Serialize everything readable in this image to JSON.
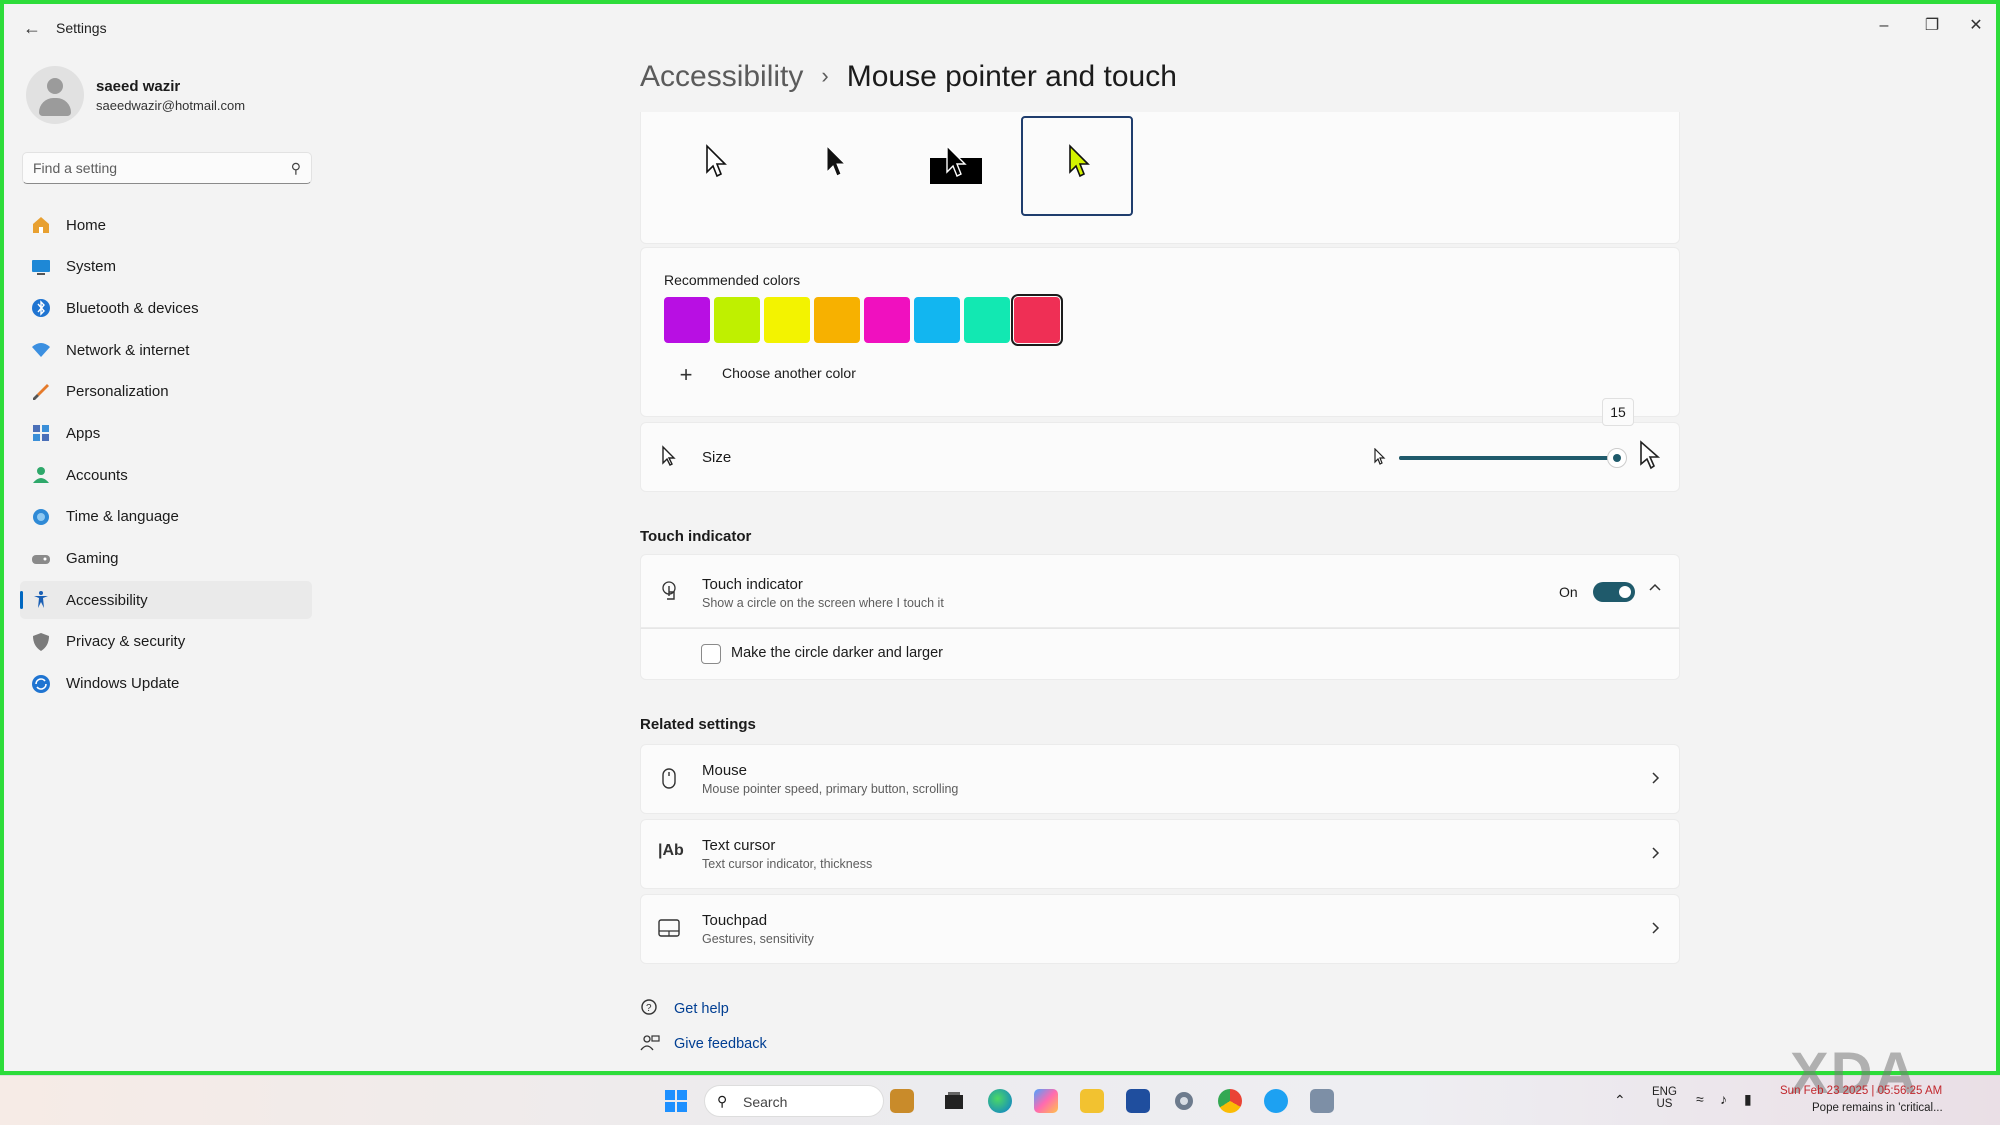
{
  "window": {
    "title": "Settings",
    "controls": [
      "minimize",
      "restore",
      "close"
    ]
  },
  "profile": {
    "name": "saeed wazir",
    "email": "saeedwazir@hotmail.com"
  },
  "search": {
    "placeholder": "Find a setting"
  },
  "sidebar": {
    "items": [
      {
        "label": "Home",
        "icon": "home-icon"
      },
      {
        "label": "System",
        "icon": "system-icon"
      },
      {
        "label": "Bluetooth & devices",
        "icon": "bluetooth-icon"
      },
      {
        "label": "Network & internet",
        "icon": "network-icon"
      },
      {
        "label": "Personalization",
        "icon": "brush-icon"
      },
      {
        "label": "Apps",
        "icon": "apps-icon"
      },
      {
        "label": "Accounts",
        "icon": "accounts-icon"
      },
      {
        "label": "Time & language",
        "icon": "globe-icon"
      },
      {
        "label": "Gaming",
        "icon": "gamepad-icon"
      },
      {
        "label": "Accessibility",
        "icon": "accessibility-icon",
        "active": true
      },
      {
        "label": "Privacy & security",
        "icon": "shield-icon"
      },
      {
        "label": "Windows Update",
        "icon": "update-icon"
      }
    ]
  },
  "breadcrumb": {
    "parent": "Accessibility",
    "current": "Mouse pointer and touch"
  },
  "pointer_styles": {
    "selected_index": 3,
    "styles": [
      "white",
      "black",
      "inverted",
      "custom"
    ]
  },
  "colors": {
    "label": "Recommended colors",
    "swatches": [
      "#b80fe3",
      "#bff000",
      "#f3f300",
      "#f7b100",
      "#f010bf",
      "#12b6f0",
      "#12e8b2",
      "#ef2f55"
    ],
    "selected_index": 7,
    "choose_another": "Choose another color"
  },
  "size": {
    "label": "Size",
    "value": "15",
    "fraction": 1.0
  },
  "touch": {
    "section_title": "Touch indicator",
    "title": "Touch indicator",
    "subtitle": "Show a circle on the screen where I touch it",
    "state": "On",
    "checkbox_label": "Make the circle darker and larger",
    "checked": false
  },
  "related": {
    "title": "Related settings",
    "items": [
      {
        "title": "Mouse",
        "subtitle": "Mouse pointer speed, primary button, scrolling",
        "icon": "mouse-icon"
      },
      {
        "title": "Text cursor",
        "subtitle": "Text cursor indicator, thickness",
        "icon": "text-cursor-icon"
      },
      {
        "title": "Touchpad",
        "subtitle": "Gestures, sensitivity",
        "icon": "touchpad-icon"
      }
    ]
  },
  "help": {
    "get_help": "Get help",
    "give_feedback": "Give feedback"
  },
  "taskbar": {
    "search": "Search",
    "lang_1": "ENG",
    "lang_2": "US",
    "clock": "Sun Feb 23 2025 | 05:56:25 AM",
    "news": "Pope remains in 'critical...",
    "watermark": "XDA"
  }
}
